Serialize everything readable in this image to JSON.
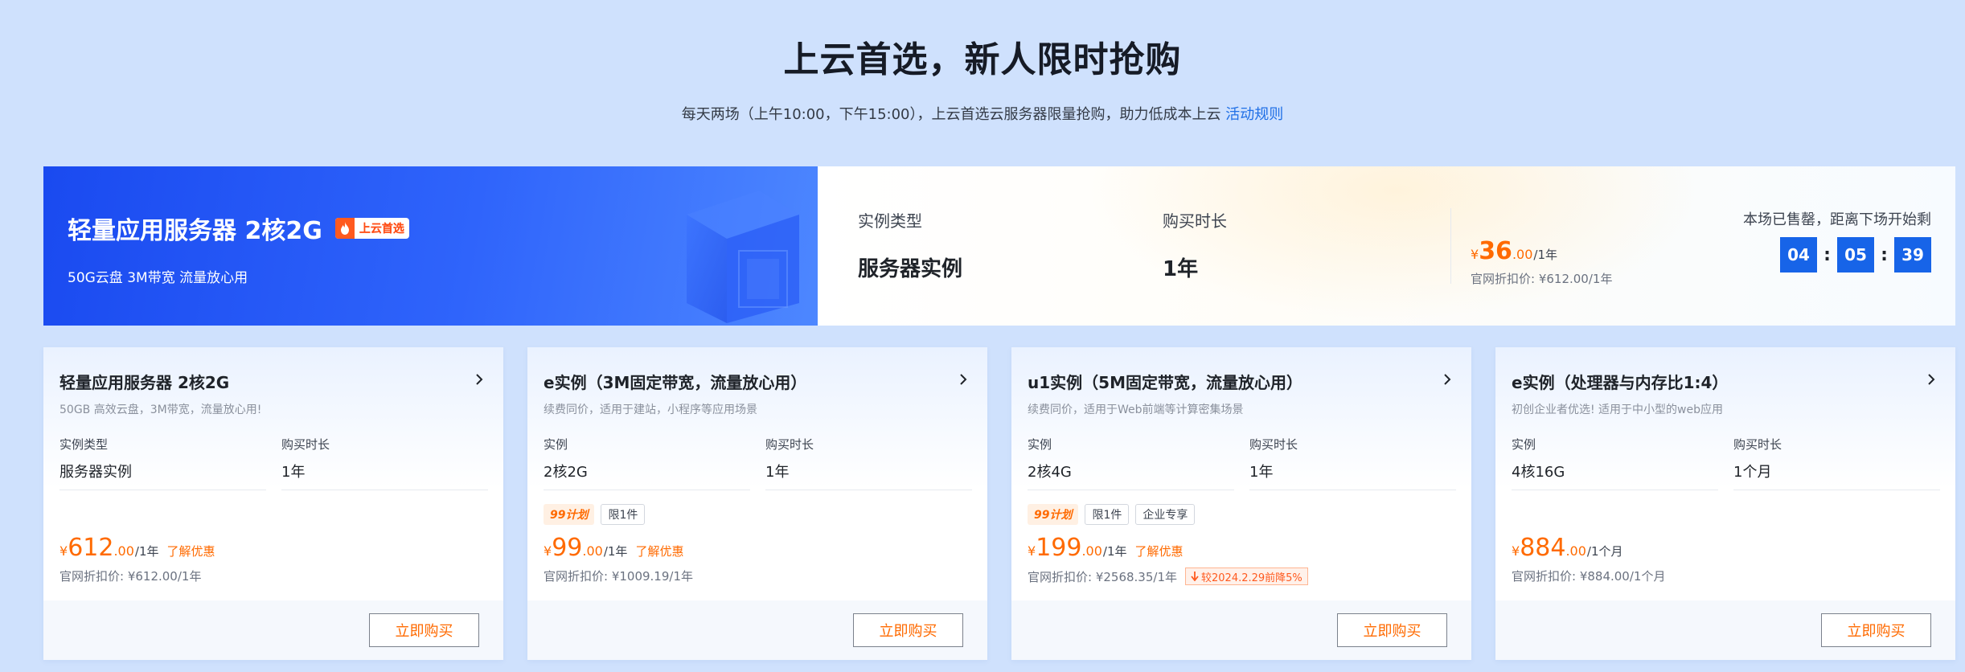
{
  "header": {
    "title": "上云首选，新人限时抢购",
    "subtitle": "每天两场（上午10:00，下午15:00），上云首选云服务器限量抢购，助力低成本上云 ",
    "rules_link": "活动规则"
  },
  "hero": {
    "title": "轻量应用服务器 2核2G",
    "badge": "上云首选",
    "desc": "50G云盘 3M带宽 流量放心用",
    "type_label": "实例类型",
    "type_value": "服务器实例",
    "duration_label": "购买时长",
    "duration_value": "1年",
    "price": {
      "currency": "¥",
      "int": "36",
      "dec": ".00",
      "unit": "/1年"
    },
    "original": "官网折扣价: ¥612.00/1年",
    "countdown_label": "本场已售罄，距离下场开始剩",
    "countdown": {
      "h": "04",
      "m": "05",
      "s": "39"
    }
  },
  "cards": [
    {
      "title": "轻量应用服务器 2核2G",
      "subtitle": "50GB 高效云盘，3M带宽，流量放心用!",
      "spec_label": "实例类型",
      "spec_value": "服务器实例",
      "duration_label": "购买时长",
      "duration_value": "1年",
      "price": {
        "currency": "¥",
        "int": "612",
        "dec": ".00",
        "unit": "/1年"
      },
      "discount_link": "了解优惠",
      "original": "官网折扣价: ¥612.00/1年",
      "buy": "立即购买"
    },
    {
      "title": "e实例（3M固定带宽，流量放心用）",
      "subtitle": "续费同价，适用于建站，小程序等应用场景",
      "spec_label": "实例",
      "spec_value": "2核2G",
      "duration_label": "购买时长",
      "duration_value": "1年",
      "tags": [
        "99计划",
        "限1件"
      ],
      "price": {
        "currency": "¥",
        "int": "99",
        "dec": ".00",
        "unit": "/1年"
      },
      "discount_link": "了解优惠",
      "original": "官网折扣价: ¥1009.19/1年",
      "buy": "立即购买"
    },
    {
      "title": "u1实例（5M固定带宽，流量放心用）",
      "subtitle": "续费同价，适用于Web前端等计算密集场景",
      "spec_label": "实例",
      "spec_value": "2核4G",
      "duration_label": "购买时长",
      "duration_value": "1年",
      "tags": [
        "99计划",
        "限1件",
        "企业专享"
      ],
      "price": {
        "currency": "¥",
        "int": "199",
        "dec": ".00",
        "unit": "/1年"
      },
      "discount_link": "了解优惠",
      "original": "官网折扣价: ¥2568.35/1年",
      "drop_badge": "较2024.2.29前降5%",
      "buy": "立即购买"
    },
    {
      "title": "e实例（处理器与内存比1:4）",
      "subtitle": "初创企业者优选! 适用于中小型的web应用",
      "spec_label": "实例",
      "spec_value": "4核16G",
      "duration_label": "购买时长",
      "duration_value": "1个月",
      "price": {
        "currency": "¥",
        "int": "884",
        "dec": ".00",
        "unit": "/1个月"
      },
      "original": "官网折扣价: ¥884.00/1个月",
      "buy": "立即购买"
    }
  ],
  "colors": {
    "background": "#cfe1fd",
    "primary_blue": "#1764e8",
    "price_orange": "#ff6a00"
  },
  "icons": [
    "flame-icon",
    "chevron-right-icon",
    "arrow-down-icon",
    "server-illustration"
  ]
}
